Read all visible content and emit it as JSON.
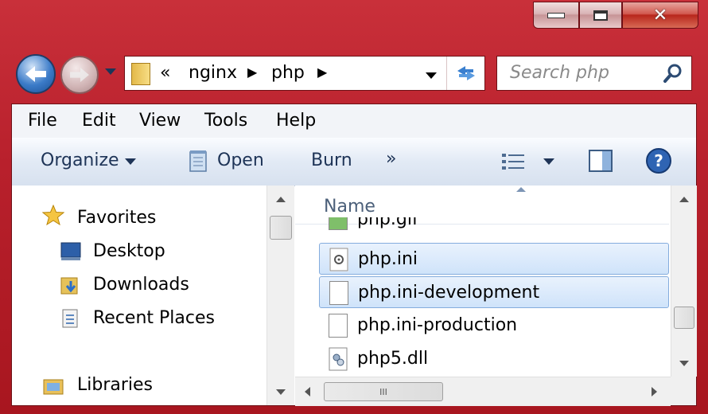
{
  "window": {
    "caption_buttons": {
      "minimize": "minimize",
      "maximize": "maximize",
      "close": "close"
    },
    "accent_color": "#b81c28"
  },
  "address_bar": {
    "chevron": "«",
    "crumbs": [
      "nginx",
      "php"
    ],
    "separator": "▶"
  },
  "search": {
    "placeholder": "Search php"
  },
  "menu": [
    "File",
    "Edit",
    "View",
    "Tools",
    "Help"
  ],
  "toolbar": {
    "organize": "Organize",
    "open": "Open",
    "burn": "Burn",
    "more": "»"
  },
  "nav_pane": {
    "favorites": "Favorites",
    "items": [
      "Desktop",
      "Downloads",
      "Recent Places"
    ],
    "libraries": "Libraries"
  },
  "file_list": {
    "column_name": "Name",
    "partial_top": "php.gif",
    "rows": [
      {
        "name": "php.ini",
        "selected": true,
        "icon": "config-file-icon"
      },
      {
        "name": "php.ini-development",
        "selected": true,
        "icon": "blank-file-icon"
      },
      {
        "name": "php.ini-production",
        "selected": false,
        "icon": "blank-file-icon"
      },
      {
        "name": "php5.dll",
        "selected": false,
        "icon": "dll-file-icon"
      }
    ],
    "hscroll_grip": "III"
  }
}
